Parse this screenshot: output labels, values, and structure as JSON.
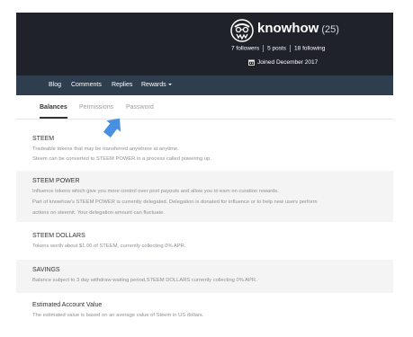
{
  "profile": {
    "username": "knowhow",
    "reputation": "(25)",
    "followers": "7 followers",
    "posts": "5 posts",
    "following": "18 following",
    "joined": "Joined December 2017"
  },
  "nav": {
    "items": [
      "Blog",
      "Comments",
      "Replies",
      "Rewards"
    ]
  },
  "tabs": [
    "Balances",
    "Permissions",
    "Password"
  ],
  "sections": [
    {
      "title": "STEEM",
      "lines": [
        "Tradeable tokens that may be transferred anywhere at anytime.",
        "Steem can be converted to STEEM POWER in a process called powering up."
      ]
    },
    {
      "title": "STEEM POWER",
      "lines": [
        "Influence tokens which give you more control over post payouts and allow you to earn on curation rewards.",
        "Part of knowhow's STEEM POWER is currently delegated. Delegation is donated for influence or to help new users perform",
        "actions on steemit. Your delegation amount can fluctuate."
      ]
    },
    {
      "title": "STEEM DOLLARS",
      "lines": [
        "Tokens worth about $1.00 of STEEM, currently collecting 0% APR."
      ]
    },
    {
      "title": "SAVINGS",
      "lines": [
        "Balance subject to 3 day withdraw waiting period,STEEM DOLLARS currently collecting 0% APR."
      ]
    },
    {
      "title": "Estimated Account Value",
      "lines": [
        "The estimated value is based on an average value of Steem in US dollars."
      ]
    }
  ]
}
